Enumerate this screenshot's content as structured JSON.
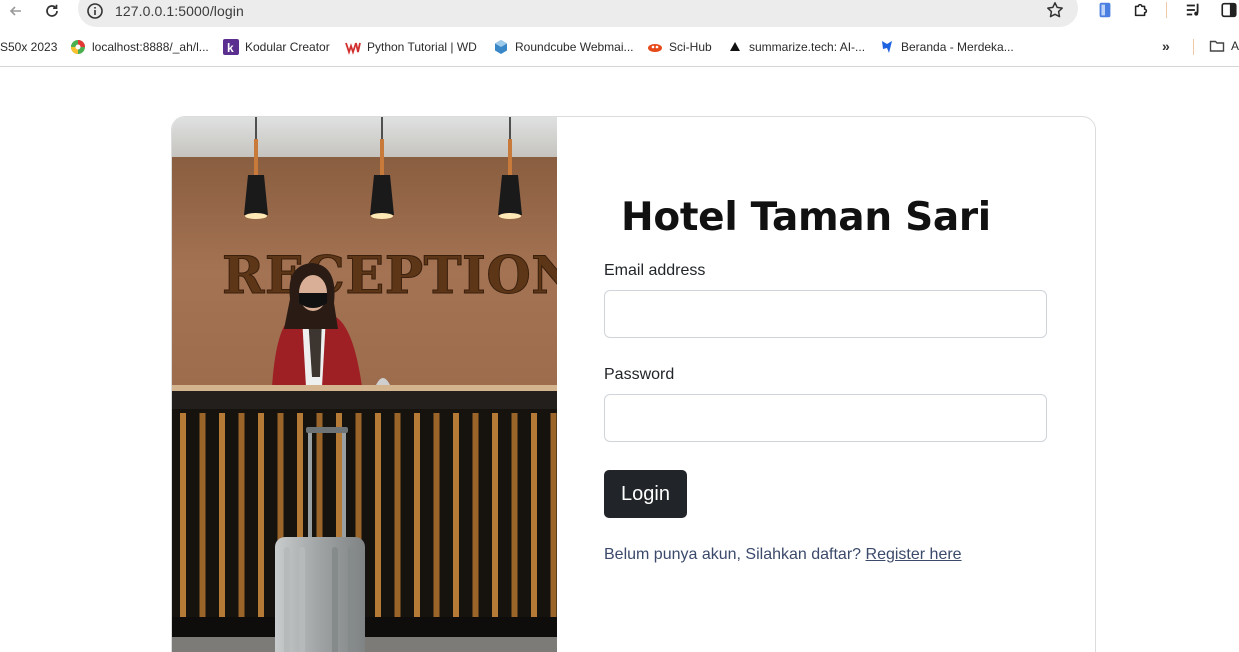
{
  "browser": {
    "url": "127.0.0.1:5000/login",
    "icons": [
      "back-arrow-icon",
      "reload-icon",
      "site-info-icon",
      "bookmark-star-icon",
      "extension-icon",
      "puzzle-icon",
      "reading-list-icon",
      "side-panel-icon"
    ]
  },
  "bookmarks": {
    "items": [
      {
        "label": "S50x 2023",
        "icon": "none"
      },
      {
        "label": "localhost:8888/_ah/l...",
        "icon": "google-app-engine-icon"
      },
      {
        "label": "Kodular Creator",
        "icon": "kodular-icon"
      },
      {
        "label": "Python Tutorial | WD",
        "icon": "wd-icon"
      },
      {
        "label": "Roundcube Webmai...",
        "icon": "roundcube-icon"
      },
      {
        "label": "Sci-Hub",
        "icon": "sci-hub-icon"
      },
      {
        "label": "summarize.tech: AI-...",
        "icon": "triangle-icon"
      },
      {
        "label": "Beranda - Merdeka...",
        "icon": "merdeka-icon"
      }
    ],
    "more": "»",
    "folder_label": "A"
  },
  "login": {
    "title": "Hotel Taman Sari",
    "email_label": "Email address",
    "email_value": "",
    "password_label": "Password",
    "password_value": "",
    "button_label": "Login",
    "register_text": "Belum punya akun, Silahkan daftar?",
    "register_link": "Register here"
  },
  "photo": {
    "sign_text": "RECEPTION"
  },
  "colors": {
    "button_bg": "#212529",
    "link": "#3b4a6b",
    "wall": "#9a6a47"
  }
}
